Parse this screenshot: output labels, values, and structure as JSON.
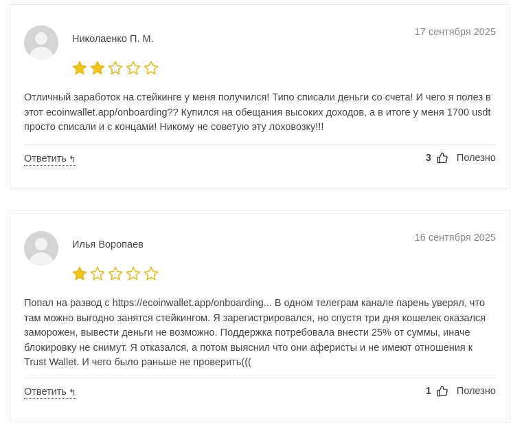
{
  "reviews": [
    {
      "author": "Николаенко П. М.",
      "date": "17 сентября 2025",
      "rating": 2,
      "max_rating": 5,
      "text": "Отличный заработок на стейкинге у меня получился! Типо списали деньги со счета! И чего я полез в этот ecoinwallet.app/onboarding?? Купился на обещания высоких доходов, а в итоге у меня 1700 usdt просто списали и с концами! Никому не советую эту лоховозку!!!",
      "reply_label": "Ответить",
      "helpful_count": "3",
      "helpful_label": "Полезно"
    },
    {
      "author": "Илья Воропаев",
      "date": "16 сентября 2025",
      "rating": 1,
      "max_rating": 5,
      "text": "Попал на развод с https://ecoinwallet.app/onboarding... В одном телеграм канале парень уверял, что там можно выгодно занятся стейкингом. Я зарегистрировался, но спустя три дня кошелек оказался заморожен, вывести деньги не возможно. Поддержка потребовала внести 25% от суммы, иначе блокировку не снимут. Я отказался, а потом выяснил что они аферисты и не имеют отношения к Trust Wallet. И чего было раньше не проверить(((",
      "reply_label": "Ответить",
      "helpful_count": "1",
      "helpful_label": "Полезно"
    }
  ],
  "icons": {
    "star": "star-icon",
    "thumb": "thumbs-up-icon",
    "reply": "reply-arrow-icon",
    "avatar": "user-avatar-icon"
  },
  "colors": {
    "star_filled": "#f0c419",
    "star_outline": "#e2b917"
  }
}
